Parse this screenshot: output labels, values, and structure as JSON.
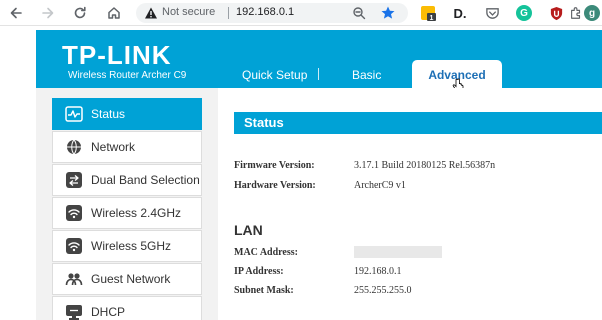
{
  "browser": {
    "security_label": "Not secure",
    "url": "192.168.0.1",
    "extensions": [
      {
        "name": "sticky-note-icon",
        "badge": "1"
      },
      {
        "name": "d-extension-icon",
        "text": "D."
      },
      {
        "name": "pocket-icon"
      },
      {
        "name": "grammarly-icon",
        "text": "G"
      },
      {
        "name": "ublock-icon"
      },
      {
        "name": "puzzle-icon"
      },
      {
        "name": "profile-icon",
        "text": "g"
      }
    ]
  },
  "header": {
    "brand": "TP-LINK",
    "model": "Wireless Router Archer C9",
    "tabs": [
      {
        "label": "Quick Setup"
      },
      {
        "label": "Basic"
      },
      {
        "label": "Advanced",
        "active": true
      }
    ]
  },
  "sidebar": {
    "items": [
      {
        "label": "Status",
        "icon": "status-icon",
        "active": true
      },
      {
        "label": "Network",
        "icon": "globe-icon"
      },
      {
        "label": "Dual Band Selection",
        "icon": "dual-band-icon"
      },
      {
        "label": "Wireless 2.4GHz",
        "icon": "wifi-icon"
      },
      {
        "label": "Wireless 5GHz",
        "icon": "wifi-icon"
      },
      {
        "label": "Guest Network",
        "icon": "guest-icon"
      },
      {
        "label": "DHCP",
        "icon": "dhcp-icon"
      }
    ]
  },
  "main": {
    "section_title": "Status",
    "firmware_label": "Firmware Version:",
    "firmware_value": "3.17.1 Build 20180125 Rel.56387n",
    "hardware_label": "Hardware Version:",
    "hardware_value": "ArcherC9 v1",
    "lan_title": "LAN",
    "mac_label": "MAC Address:",
    "ip_label": "IP Address:",
    "ip_value": "192.168.0.1",
    "mask_label": "Subnet Mask:",
    "mask_value": "255.255.255.0"
  },
  "colors": {
    "brand_blue": "#00a2d6",
    "active_tab_text": "#1d6fb5",
    "sidebar_bg": "#f2f2f2"
  }
}
